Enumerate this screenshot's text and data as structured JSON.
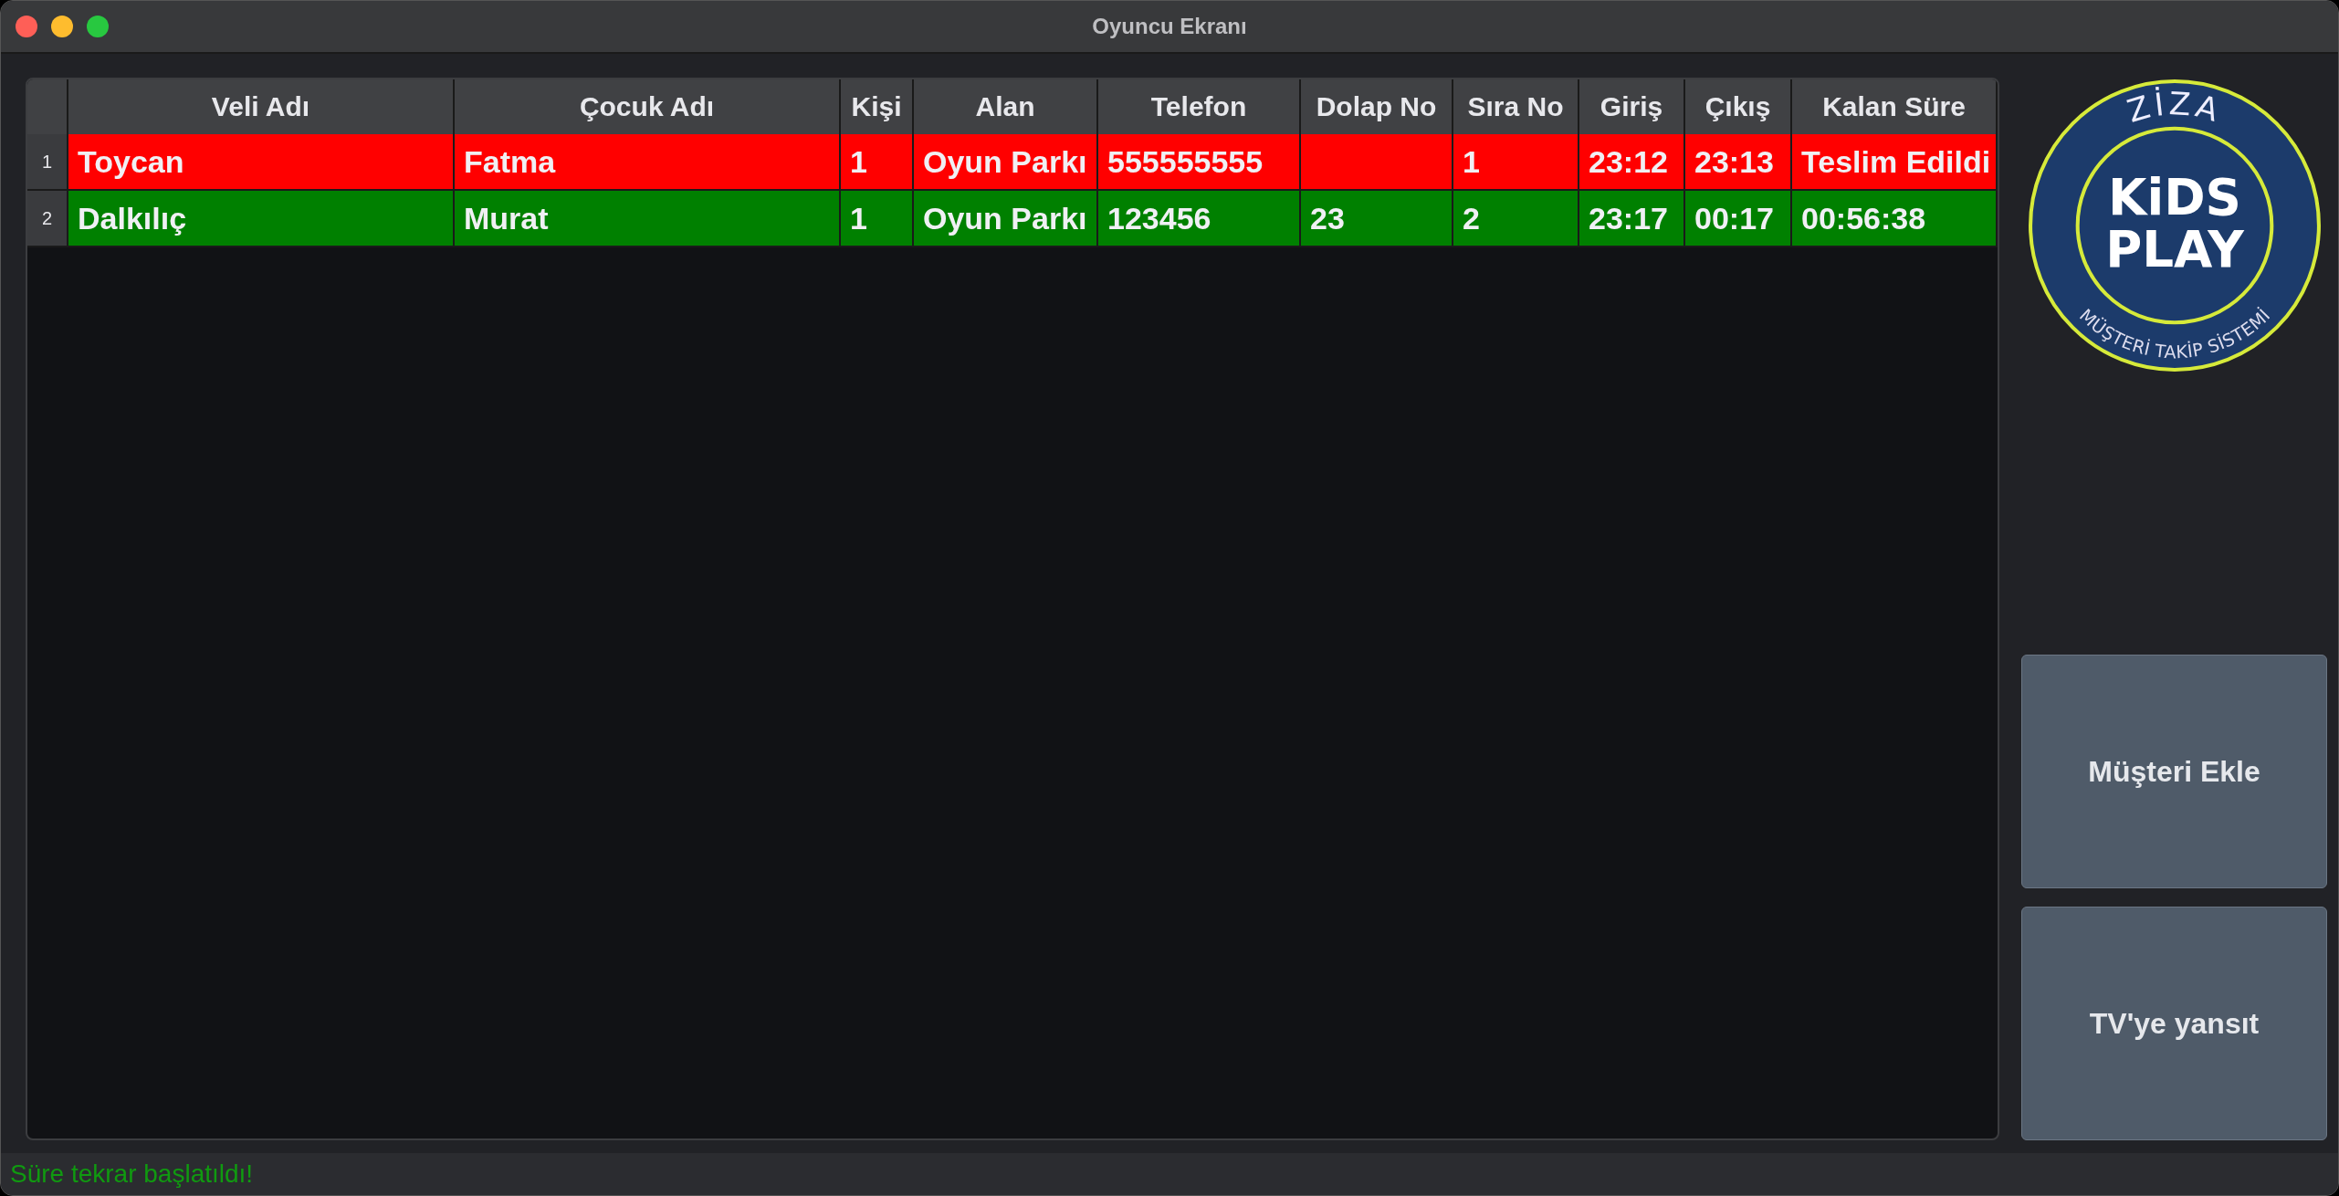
{
  "window": {
    "title": "Oyuncu Ekranı"
  },
  "table": {
    "columns": [
      "Veli Adı",
      "Çocuk Adı",
      "Kişi",
      "Alan",
      "Telefon",
      "Dolap No",
      "Sıra No",
      "Giriş",
      "Çıkış",
      "Kalan Süre"
    ],
    "rows": [
      {
        "number": "1",
        "color": "#ff0000",
        "cells": [
          "Toycan",
          "Fatma",
          "1",
          "Oyun Parkı",
          "555555555",
          "",
          "1",
          "23:12",
          "23:13",
          "Teslim Edildi"
        ]
      },
      {
        "number": "2",
        "color": "#008000",
        "cells": [
          "Dalkılıç",
          "Murat",
          "1",
          "Oyun Parkı",
          "123456",
          "23",
          "2",
          "23:17",
          "00:17",
          "00:56:38"
        ]
      }
    ]
  },
  "logo": {
    "top": "ZİZA",
    "line_1": "KiDS",
    "line_2": "PLAY",
    "bottom": "MÜŞTERİ TAKİP SİSTEMİ"
  },
  "buttons": [
    "Müşteri Ekle",
    "TV'ye yansıt"
  ],
  "status_bar": {
    "message": "Süre tekrar başlatıldı!"
  }
}
